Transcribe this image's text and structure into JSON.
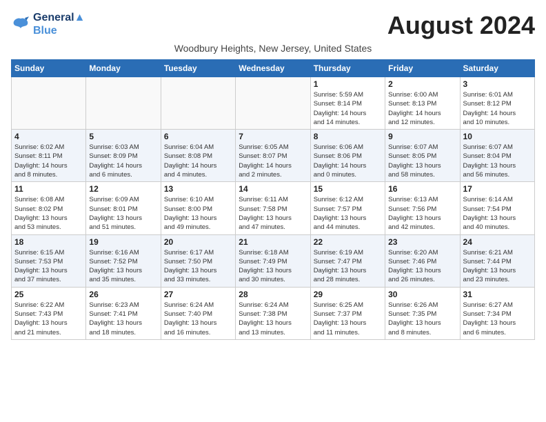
{
  "logo": {
    "line1": "General",
    "line2": "Blue"
  },
  "title": "August 2024",
  "subtitle": "Woodbury Heights, New Jersey, United States",
  "weekdays": [
    "Sunday",
    "Monday",
    "Tuesday",
    "Wednesday",
    "Thursday",
    "Friday",
    "Saturday"
  ],
  "weeks": [
    [
      {
        "day": "",
        "info": ""
      },
      {
        "day": "",
        "info": ""
      },
      {
        "day": "",
        "info": ""
      },
      {
        "day": "",
        "info": ""
      },
      {
        "day": "1",
        "info": "Sunrise: 5:59 AM\nSunset: 8:14 PM\nDaylight: 14 hours\nand 14 minutes."
      },
      {
        "day": "2",
        "info": "Sunrise: 6:00 AM\nSunset: 8:13 PM\nDaylight: 14 hours\nand 12 minutes."
      },
      {
        "day": "3",
        "info": "Sunrise: 6:01 AM\nSunset: 8:12 PM\nDaylight: 14 hours\nand 10 minutes."
      }
    ],
    [
      {
        "day": "4",
        "info": "Sunrise: 6:02 AM\nSunset: 8:11 PM\nDaylight: 14 hours\nand 8 minutes."
      },
      {
        "day": "5",
        "info": "Sunrise: 6:03 AM\nSunset: 8:09 PM\nDaylight: 14 hours\nand 6 minutes."
      },
      {
        "day": "6",
        "info": "Sunrise: 6:04 AM\nSunset: 8:08 PM\nDaylight: 14 hours\nand 4 minutes."
      },
      {
        "day": "7",
        "info": "Sunrise: 6:05 AM\nSunset: 8:07 PM\nDaylight: 14 hours\nand 2 minutes."
      },
      {
        "day": "8",
        "info": "Sunrise: 6:06 AM\nSunset: 8:06 PM\nDaylight: 14 hours\nand 0 minutes."
      },
      {
        "day": "9",
        "info": "Sunrise: 6:07 AM\nSunset: 8:05 PM\nDaylight: 13 hours\nand 58 minutes."
      },
      {
        "day": "10",
        "info": "Sunrise: 6:07 AM\nSunset: 8:04 PM\nDaylight: 13 hours\nand 56 minutes."
      }
    ],
    [
      {
        "day": "11",
        "info": "Sunrise: 6:08 AM\nSunset: 8:02 PM\nDaylight: 13 hours\nand 53 minutes."
      },
      {
        "day": "12",
        "info": "Sunrise: 6:09 AM\nSunset: 8:01 PM\nDaylight: 13 hours\nand 51 minutes."
      },
      {
        "day": "13",
        "info": "Sunrise: 6:10 AM\nSunset: 8:00 PM\nDaylight: 13 hours\nand 49 minutes."
      },
      {
        "day": "14",
        "info": "Sunrise: 6:11 AM\nSunset: 7:58 PM\nDaylight: 13 hours\nand 47 minutes."
      },
      {
        "day": "15",
        "info": "Sunrise: 6:12 AM\nSunset: 7:57 PM\nDaylight: 13 hours\nand 44 minutes."
      },
      {
        "day": "16",
        "info": "Sunrise: 6:13 AM\nSunset: 7:56 PM\nDaylight: 13 hours\nand 42 minutes."
      },
      {
        "day": "17",
        "info": "Sunrise: 6:14 AM\nSunset: 7:54 PM\nDaylight: 13 hours\nand 40 minutes."
      }
    ],
    [
      {
        "day": "18",
        "info": "Sunrise: 6:15 AM\nSunset: 7:53 PM\nDaylight: 13 hours\nand 37 minutes."
      },
      {
        "day": "19",
        "info": "Sunrise: 6:16 AM\nSunset: 7:52 PM\nDaylight: 13 hours\nand 35 minutes."
      },
      {
        "day": "20",
        "info": "Sunrise: 6:17 AM\nSunset: 7:50 PM\nDaylight: 13 hours\nand 33 minutes."
      },
      {
        "day": "21",
        "info": "Sunrise: 6:18 AM\nSunset: 7:49 PM\nDaylight: 13 hours\nand 30 minutes."
      },
      {
        "day": "22",
        "info": "Sunrise: 6:19 AM\nSunset: 7:47 PM\nDaylight: 13 hours\nand 28 minutes."
      },
      {
        "day": "23",
        "info": "Sunrise: 6:20 AM\nSunset: 7:46 PM\nDaylight: 13 hours\nand 26 minutes."
      },
      {
        "day": "24",
        "info": "Sunrise: 6:21 AM\nSunset: 7:44 PM\nDaylight: 13 hours\nand 23 minutes."
      }
    ],
    [
      {
        "day": "25",
        "info": "Sunrise: 6:22 AM\nSunset: 7:43 PM\nDaylight: 13 hours\nand 21 minutes."
      },
      {
        "day": "26",
        "info": "Sunrise: 6:23 AM\nSunset: 7:41 PM\nDaylight: 13 hours\nand 18 minutes."
      },
      {
        "day": "27",
        "info": "Sunrise: 6:24 AM\nSunset: 7:40 PM\nDaylight: 13 hours\nand 16 minutes."
      },
      {
        "day": "28",
        "info": "Sunrise: 6:24 AM\nSunset: 7:38 PM\nDaylight: 13 hours\nand 13 minutes."
      },
      {
        "day": "29",
        "info": "Sunrise: 6:25 AM\nSunset: 7:37 PM\nDaylight: 13 hours\nand 11 minutes."
      },
      {
        "day": "30",
        "info": "Sunrise: 6:26 AM\nSunset: 7:35 PM\nDaylight: 13 hours\nand 8 minutes."
      },
      {
        "day": "31",
        "info": "Sunrise: 6:27 AM\nSunset: 7:34 PM\nDaylight: 13 hours\nand 6 minutes."
      }
    ]
  ]
}
